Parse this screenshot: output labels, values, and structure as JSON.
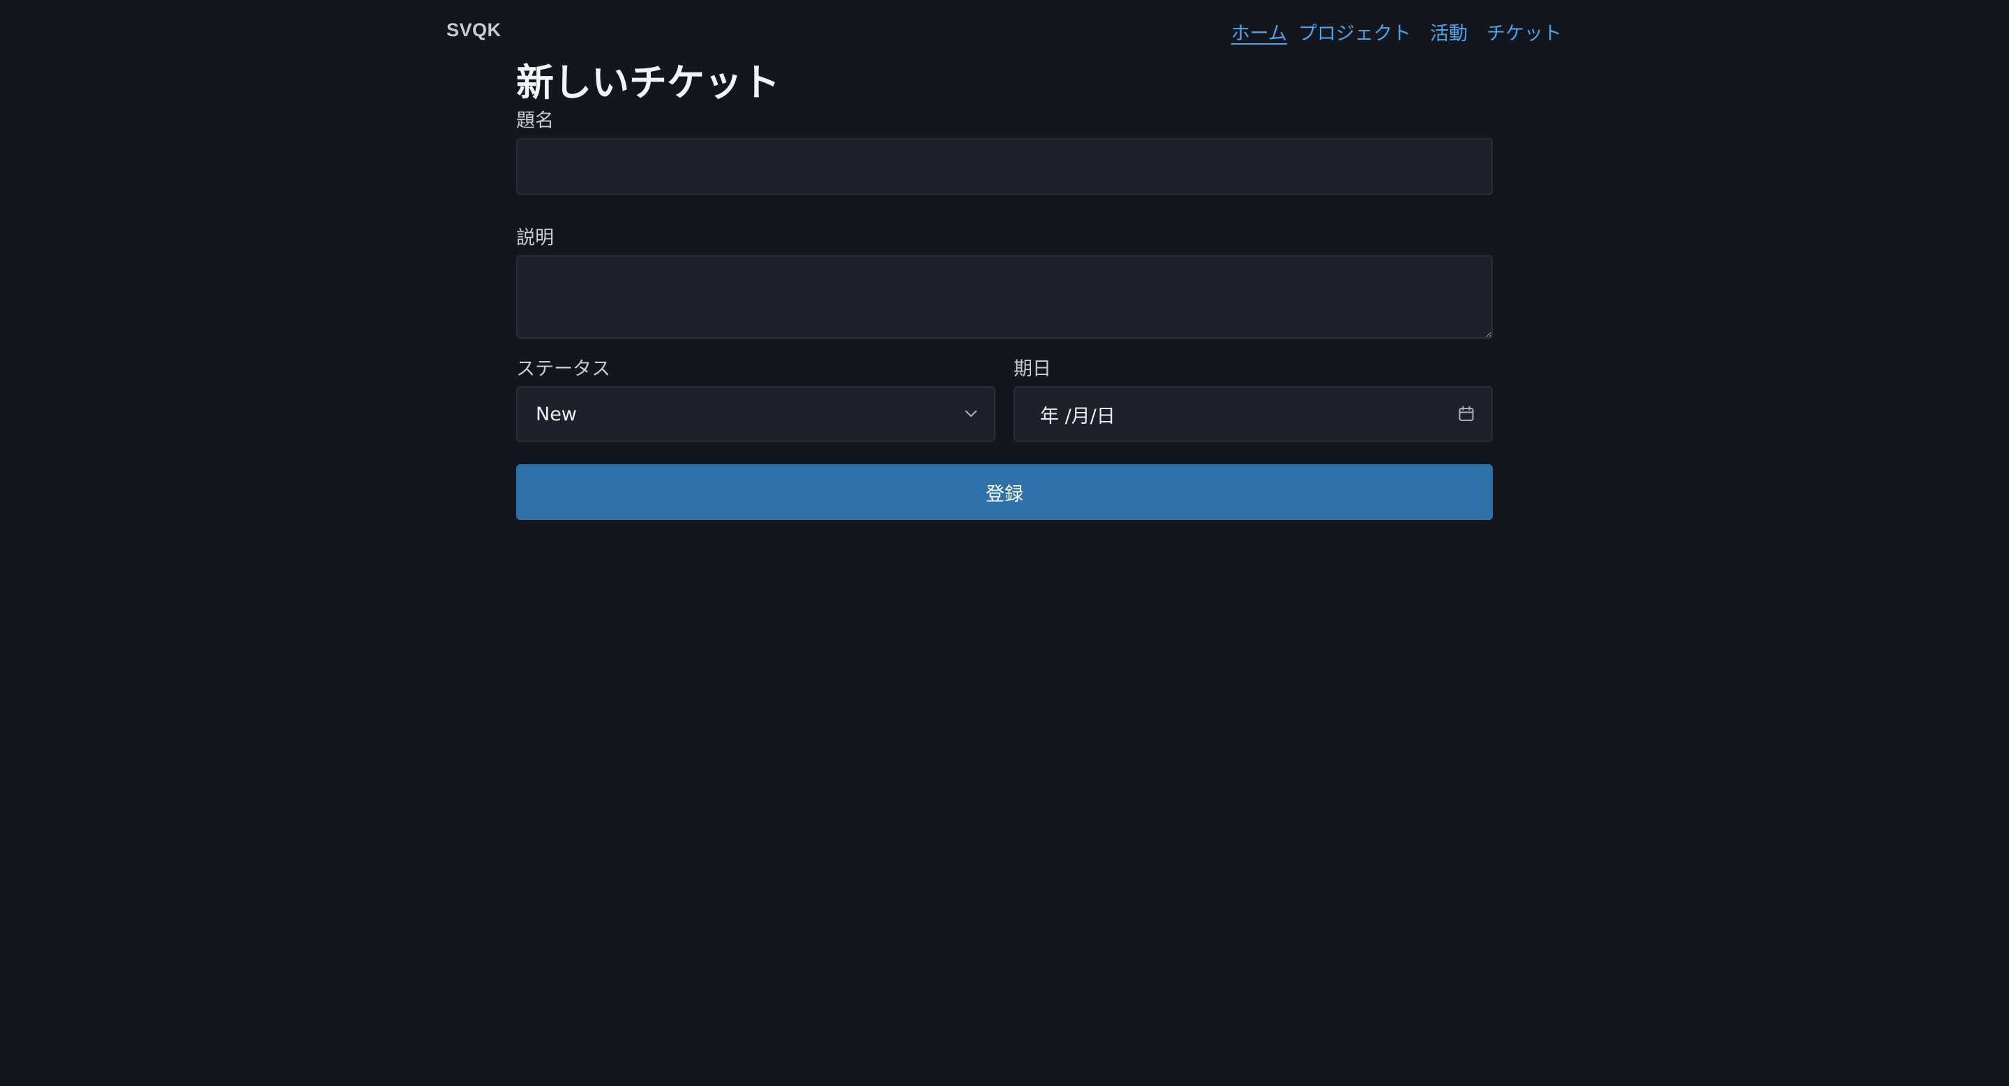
{
  "header": {
    "brand": "SVQK",
    "nav": [
      {
        "label": "ホーム",
        "active": true
      },
      {
        "label": "プロジェクト",
        "active": false
      },
      {
        "label": "活動",
        "active": false
      },
      {
        "label": "チケット",
        "active": false
      }
    ]
  },
  "form": {
    "title": "新しいチケット",
    "subject": {
      "label": "題名",
      "value": ""
    },
    "description": {
      "label": "説明",
      "value": ""
    },
    "status": {
      "label": "ステータス",
      "value": "New",
      "icon": "chevron-down-icon"
    },
    "due_date": {
      "label": "期日",
      "value": "年 /月/日",
      "icon": "calendar-icon"
    },
    "submit_label": "登録"
  },
  "colors": {
    "background": "#14161e",
    "field": "#1e212a",
    "link": "#4fa3e6",
    "primary_button": "#2e70a8"
  }
}
